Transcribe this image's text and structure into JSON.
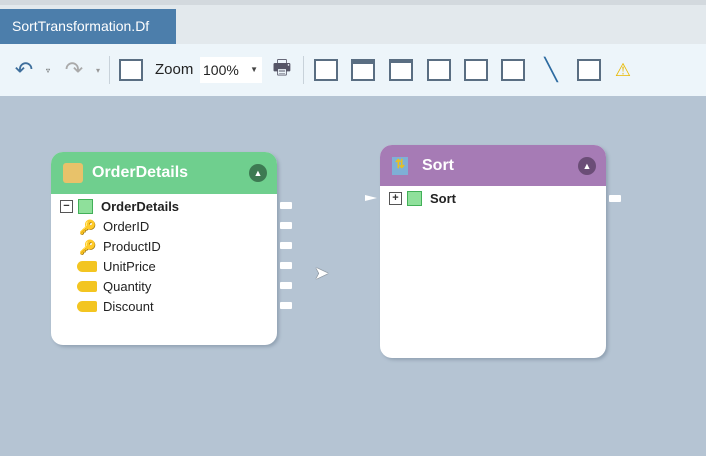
{
  "tab": {
    "title": "SortTransformation.Df"
  },
  "toolbar": {
    "zoom_label": "Zoom",
    "zoom_value": "100%"
  },
  "nodes": {
    "source": {
      "title": "OrderDetails",
      "color": "#6fcf8e",
      "table": "OrderDetails",
      "fields": [
        {
          "name": "OrderID",
          "kind": "key"
        },
        {
          "name": "ProductID",
          "kind": "key"
        },
        {
          "name": "UnitPrice",
          "kind": "field"
        },
        {
          "name": "Quantity",
          "kind": "field"
        },
        {
          "name": "Discount",
          "kind": "field"
        }
      ]
    },
    "sort": {
      "title": "Sort",
      "color": "#a67bb5",
      "table": "Sort"
    }
  }
}
